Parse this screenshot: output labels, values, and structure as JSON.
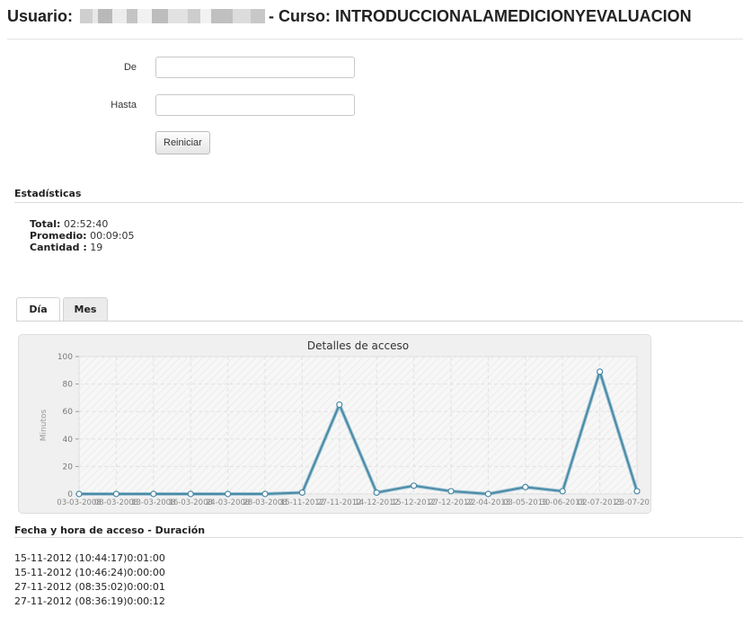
{
  "header": {
    "user_label": "Usuario:",
    "course_text": "- Curso: INTRODUCCIONALAMEDICIONYEVALUACION"
  },
  "filters": {
    "from_label": "De",
    "from_value": "",
    "to_label": "Hasta",
    "to_value": "",
    "reset_label": "Reiniciar"
  },
  "stats": {
    "title": "Estadísticas",
    "total_label": "Total:",
    "total_value": "02:52:40",
    "average_label": "Promedio:",
    "average_value": "00:09:05",
    "count_label": "Cantidad :",
    "count_value": "19"
  },
  "tabs": [
    {
      "label": "Día",
      "active": true
    },
    {
      "label": "Mes",
      "active": false
    }
  ],
  "chart_data": {
    "type": "line",
    "title": "Detalles de acceso",
    "ylabel": "Minutos",
    "xlabel": "",
    "ylim": [
      0,
      100
    ],
    "yticks": [
      0,
      20,
      40,
      60,
      80,
      100
    ],
    "grid": true,
    "categories": [
      "03-03-2008",
      "08-03-2008",
      "13-03-2008",
      "16-03-2008",
      "24-03-2008",
      "28-03-2008",
      "15-11-2012",
      "27-11-2012",
      "14-12-2012",
      "15-12-2012",
      "27-12-2012",
      "22-04-2013",
      "03-05-2013",
      "30-06-2013",
      "02-07-2013",
      "23-07-2013"
    ],
    "tick_labels_visible": [
      "03-03-2008",
      "08-03-2008",
      "13-03-2008",
      "16-03-2008",
      "24-03-2008",
      "28-03-2008",
      "15-11-2012",
      "27-11-2012",
      "14-12-2012",
      "15-12-2012",
      "27-12-2012",
      "22-04-2013",
      "03-05-2013",
      "30-06-2013",
      "02-07-2013",
      "23-07-2013"
    ],
    "values": [
      0,
      0,
      0,
      0,
      0,
      0,
      1,
      65,
      1,
      6,
      2,
      0,
      5,
      2,
      89,
      2
    ],
    "line_color": "#4a8aa6"
  },
  "log": {
    "title": "Fecha y hora de acceso - Duración",
    "rows": [
      {
        "datetime": "15-11-2012 (10:44:17)",
        "duration": "0:01:00"
      },
      {
        "datetime": "15-11-2012 (10:46:24)",
        "duration": "0:00:00"
      },
      {
        "datetime": "27-11-2012 (08:35:02)",
        "duration": "0:00:01"
      },
      {
        "datetime": "27-11-2012 (08:36:19)",
        "duration": "0:00:12"
      }
    ]
  }
}
